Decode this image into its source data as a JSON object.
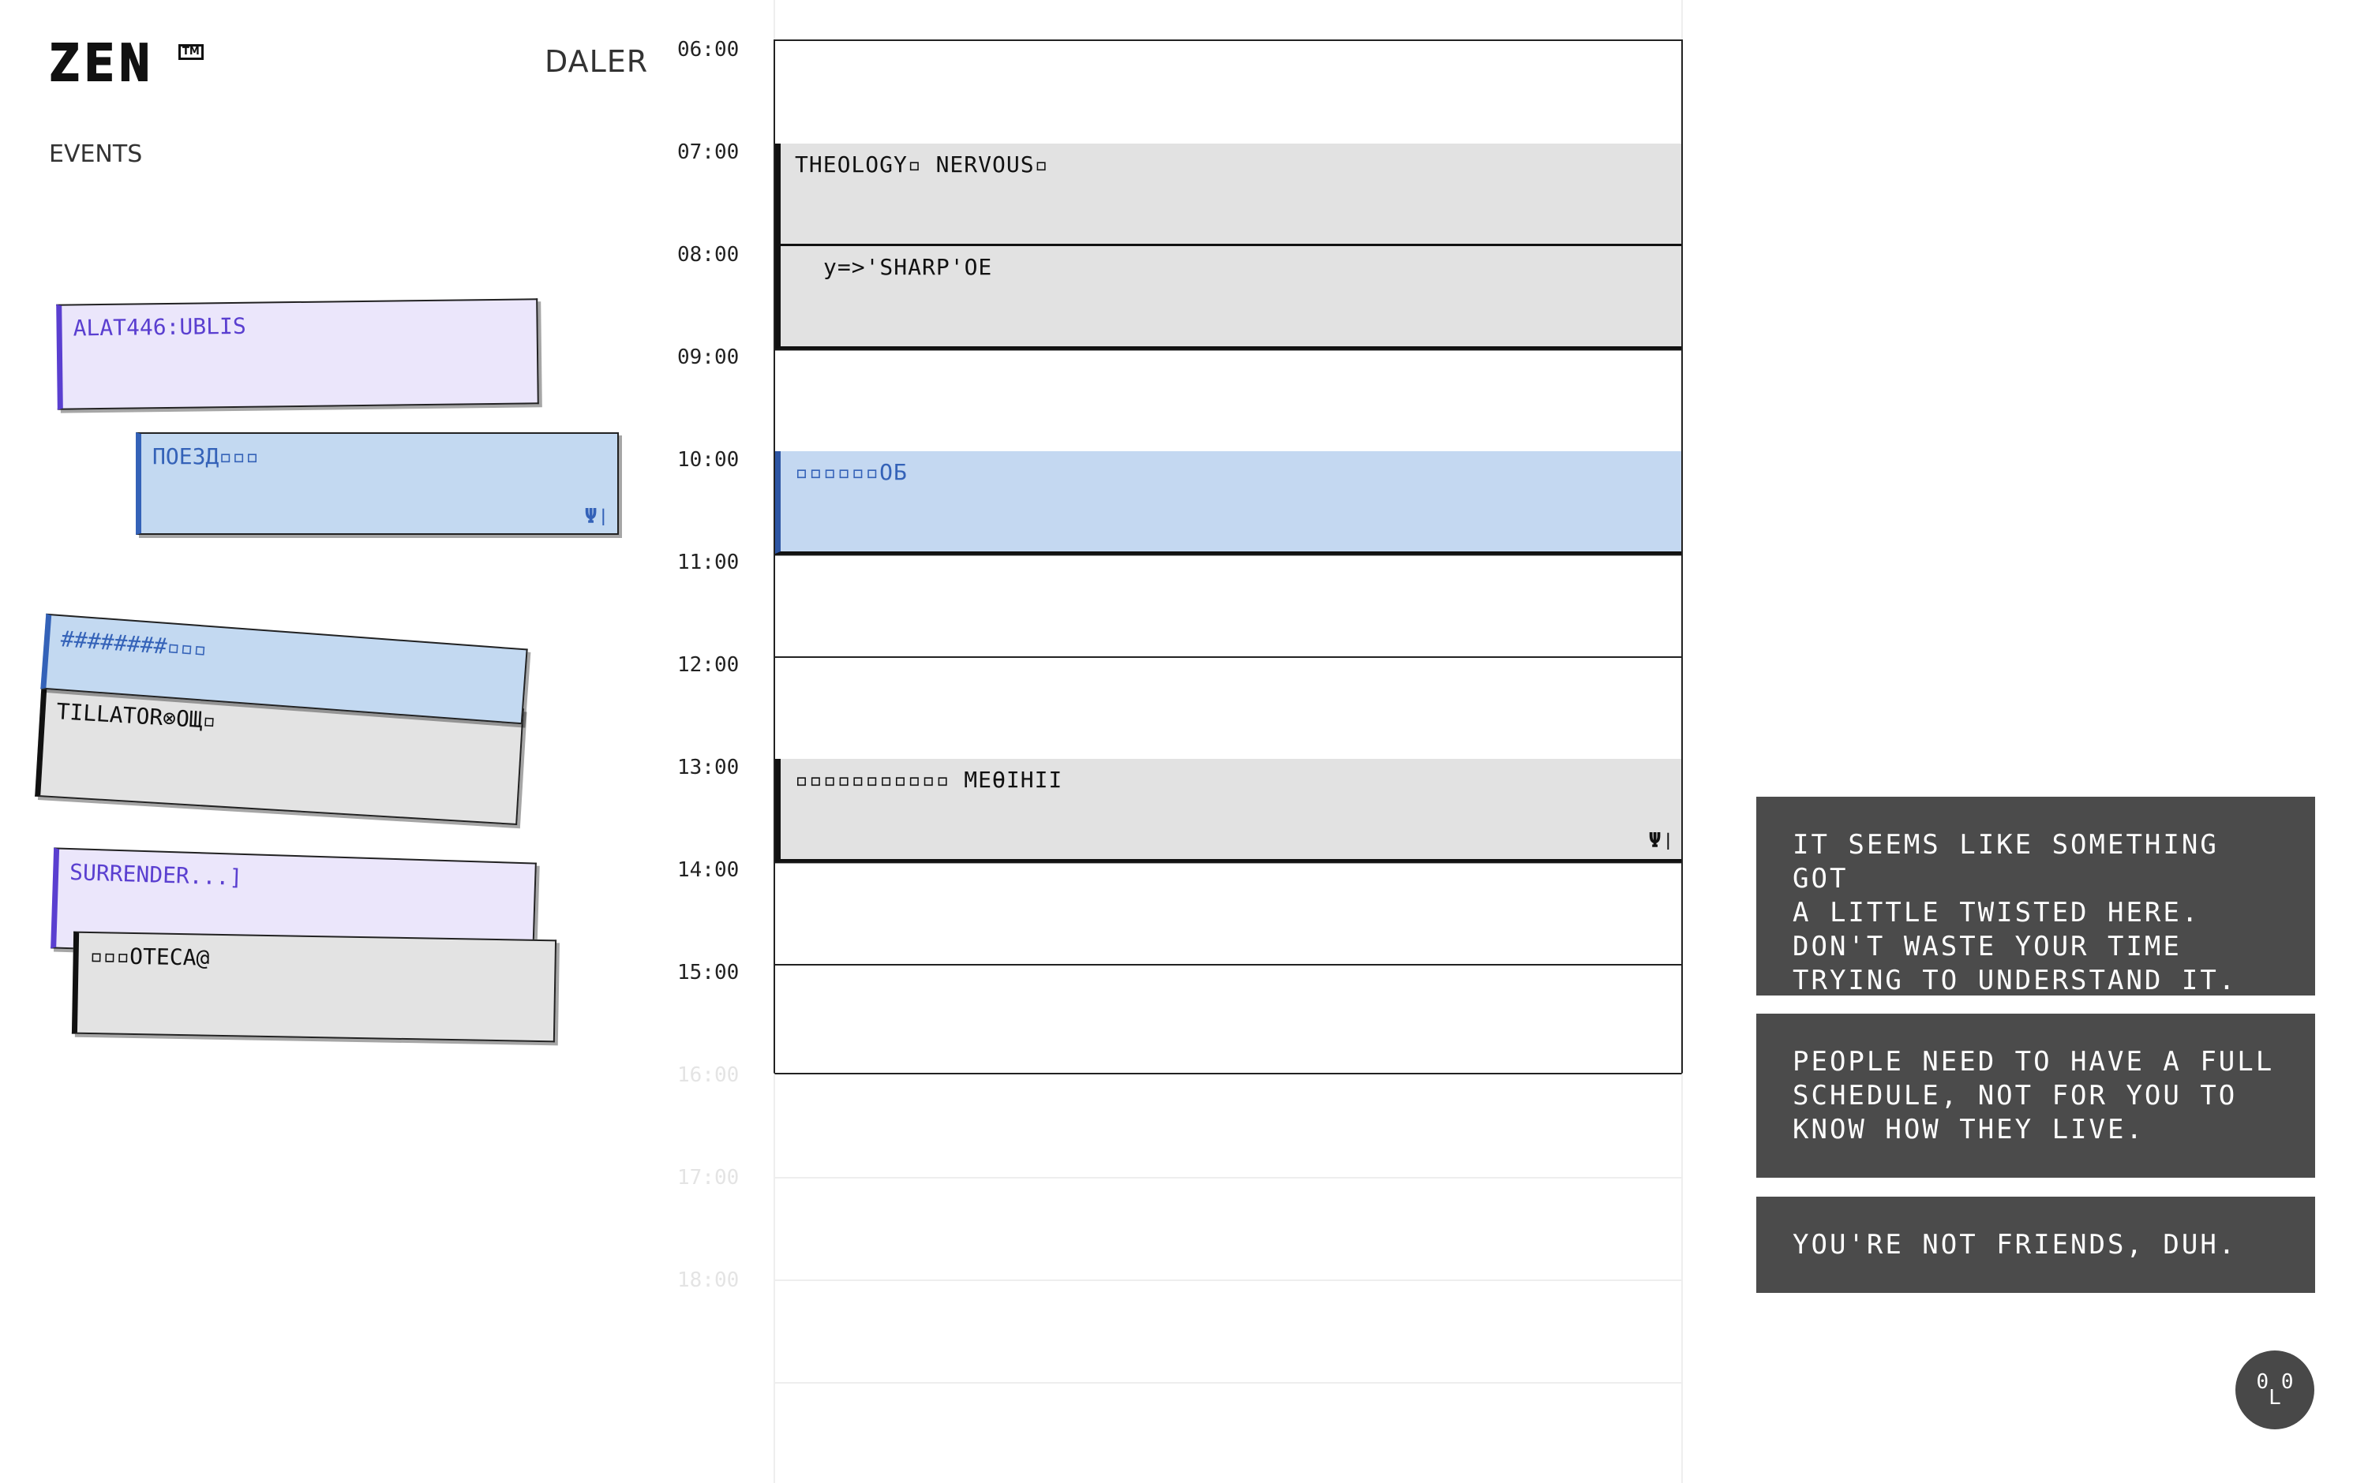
{
  "header": {
    "logo": "ZEN",
    "logo_tm": "TM",
    "username": "DALER"
  },
  "sidebar": {
    "heading": "EVENTS",
    "cards": [
      {
        "label": "ALAT446:UBLIS",
        "color": "purple"
      },
      {
        "label": "ПОЕЗД▫▫▫",
        "color": "blue",
        "meal_icon": "fork-knife-icon"
      },
      {
        "label": "########▫▫▫",
        "color": "blue"
      },
      {
        "label": "TILLATOR⊗OЩ▫",
        "color": "gray"
      },
      {
        "label": "SURRENDER...]",
        "color": "purple"
      },
      {
        "label": "▫▫▫OTECA@",
        "color": "gray"
      }
    ]
  },
  "timeline": {
    "hours": [
      "06:00",
      "07:00",
      "08:00",
      "09:00",
      "10:00",
      "11:00",
      "12:00",
      "13:00",
      "14:00",
      "15:00",
      "16:00",
      "17:00",
      "18:00"
    ],
    "events": [
      {
        "label": "THEOLOGY▫ NERVOUS▫",
        "start": "07:00",
        "end": "08:00",
        "color": "gray"
      },
      {
        "label": "y=>'SHARP'OE",
        "start": "08:00",
        "end": "09:00",
        "color": "gray"
      },
      {
        "label": "▫▫▫▫▫▫OБ",
        "start": "10:00",
        "end": "11:00",
        "color": "blue"
      },
      {
        "label": "▫▫▫▫▫▫▫▫▫▫▫ MEƟIHII",
        "start": "13:00",
        "end": "14:00",
        "color": "gray",
        "meal_icon": "fork-knife-icon"
      }
    ]
  },
  "notices": [
    "IT SEEMS LIKE SOMETHING GOT\nA LITTLE TWISTED HERE.\nDON'T WASTE YOUR TIME\nTRYING TO UNDERSTAND IT.",
    "PEOPLE NEED TO HAVE A FULL\nSCHEDULE, NOT FOR YOU TO\nKNOW HOW THEY LIVE.",
    "YOU'RE NOT FRIENDS, DUH."
  ],
  "avatar": {
    "eyes": "0 0",
    "mouth": "L"
  },
  "colors": {
    "purple_bg": "#ebe6fb",
    "purple_fg": "#5a3fd0",
    "blue_bg": "#c3d9f1",
    "blue_fg": "#3462b8",
    "gray_bg": "#e2e2e2",
    "notice_bg": "#4b4b4b"
  }
}
